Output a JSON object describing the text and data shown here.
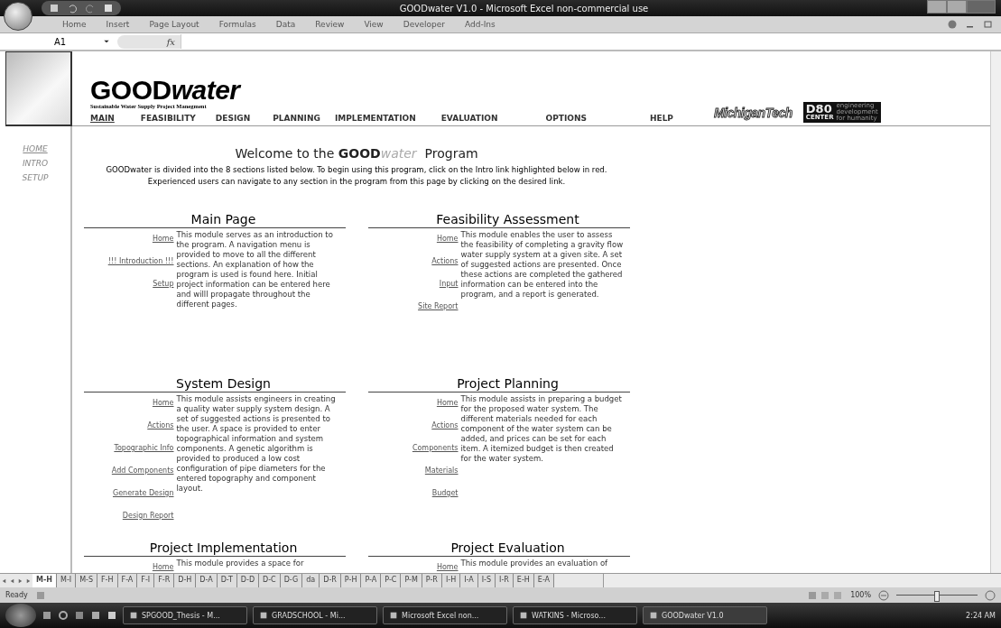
{
  "window": {
    "title": "GOODwater V1.0 - Microsoft Excel non-commercial use"
  },
  "ribbon_tabs": [
    "Home",
    "Insert",
    "Page Layout",
    "Formulas",
    "Data",
    "Review",
    "View",
    "Developer",
    "Add-Ins"
  ],
  "formula_bar": {
    "name_box": "A1",
    "function_label": "fx"
  },
  "header": {
    "logo": {
      "bold": "GOOD",
      "italic": "water"
    },
    "tagline": "Sustainable Water Supply Project Manegment",
    "nav": [
      {
        "label": "MAIN",
        "selected": true
      },
      {
        "label": "FEASIBILITY",
        "selected": false
      },
      {
        "label": "DESIGN",
        "selected": false
      },
      {
        "label": "PLANNING",
        "selected": false
      },
      {
        "label": "IMPLEMENTATION",
        "selected": false
      },
      {
        "label": "EVALUATION",
        "selected": false
      },
      {
        "label": "OPTIONS",
        "selected": false
      },
      {
        "label": "HELP",
        "selected": false
      }
    ],
    "partner_logo": "MichiganTech",
    "center_logo": {
      "mark": "D80",
      "word": "CENTER",
      "lines": [
        "engineering",
        "development",
        "for humanity"
      ]
    }
  },
  "side_nav": [
    {
      "label": "HOME",
      "selected": true
    },
    {
      "label": "INTRO",
      "selected": false
    },
    {
      "label": "SETUP",
      "selected": false
    }
  ],
  "welcome": {
    "title": {
      "before": "Welcome to the",
      "bold": "GOOD",
      "italic": "water",
      "after": "Program"
    },
    "text": "GOODwater is divided into the 8 sections listed below.  To begin using this program, click on the Intro link highlighted below in red.  Experienced users can navigate to any section in the program from this page by clicking on the desired link."
  },
  "sections": [
    {
      "title": "Main Page",
      "links": [
        "Home",
        "!!! Introduction !!!",
        "Setup"
      ],
      "text": "This module serves as an introduction to the program.  A navigation menu is provided to move to all the different sections.  An explanation of how the program is used is found here.  Initial project information can be entered here and willl propagate throughout the different pages."
    },
    {
      "title": "Feasibility Assessment",
      "links": [
        "Home",
        "Actions",
        "Input",
        "Site Report"
      ],
      "text": "This module enables the user to assess the feasibility of completing a gravity flow water supply system at a given site.  A set of suggested actions are presented.  Once these actions are completed the gathered information can be entered into the program, and a report is generated."
    },
    {
      "title": "System Design",
      "links": [
        "Home",
        "Actions",
        "Topographic Info",
        "Add Components",
        "Generate Design",
        "Design Report"
      ],
      "text": "This module assists engineers in creating a quality water supply system design.  A set of suggested actions is presented to the user.  A space is provided to enter topographical information and system components.  A genetic algorithm is provided to produced a low cost configuration of pipe diameters for the entered topography and component layout."
    },
    {
      "title": "Project Planning",
      "links": [
        "Home",
        "Actions",
        "Components",
        "Materials",
        "Budget"
      ],
      "text": "This module assists in preparing a budget for the proposed water system.  The different materials needed for each component of the water system can be added, and prices can be set for each item.  A itemized budget is then created for the water system."
    },
    {
      "title": "Project Implementation",
      "links": [
        "Home"
      ],
      "text": "This module provides a space for"
    },
    {
      "title": "Project Evaluation",
      "links": [
        "Home"
      ],
      "text": "This module provides an evaluation of"
    }
  ],
  "sheet_tabs": [
    {
      "label": "M-H",
      "selected": true
    },
    {
      "label": "M-I",
      "selected": false
    },
    {
      "label": "M-S",
      "selected": false
    },
    {
      "label": "F-H",
      "selected": false
    },
    {
      "label": "F-A",
      "selected": false
    },
    {
      "label": "F-I",
      "selected": false
    },
    {
      "label": "F-R",
      "selected": false
    },
    {
      "label": "D-H",
      "selected": false
    },
    {
      "label": "D-A",
      "selected": false
    },
    {
      "label": "D-T",
      "selected": false
    },
    {
      "label": "D-D",
      "selected": false
    },
    {
      "label": "D-C",
      "selected": false
    },
    {
      "label": "D-G",
      "selected": false
    },
    {
      "label": "da",
      "selected": false
    },
    {
      "label": "D-R",
      "selected": false
    },
    {
      "label": "P-H",
      "selected": false
    },
    {
      "label": "P-A",
      "selected": false
    },
    {
      "label": "P-C",
      "selected": false
    },
    {
      "label": "P-M",
      "selected": false
    },
    {
      "label": "P-R",
      "selected": false
    },
    {
      "label": "I-H",
      "selected": false
    },
    {
      "label": "I-A",
      "selected": false
    },
    {
      "label": "I-S",
      "selected": false
    },
    {
      "label": "I-R",
      "selected": false
    },
    {
      "label": "E-H",
      "selected": false
    },
    {
      "label": "E-A",
      "selected": false
    }
  ],
  "status_bar": {
    "status": "Ready",
    "zoom": "100%",
    "zoom_slider": {
      "level": 0.5
    }
  },
  "taskbar": {
    "items": [
      {
        "label": "SPGOOD_Thesis - M...",
        "selected": false
      },
      {
        "label": "GRADSCHOOL - Mi...",
        "selected": false
      },
      {
        "label": "Microsoft Excel non...",
        "selected": false
      },
      {
        "label": "WATKINS - Microso...",
        "selected": false
      },
      {
        "label": "GOODwater V1.0",
        "selected": true
      }
    ],
    "clock": "2:24 AM"
  }
}
